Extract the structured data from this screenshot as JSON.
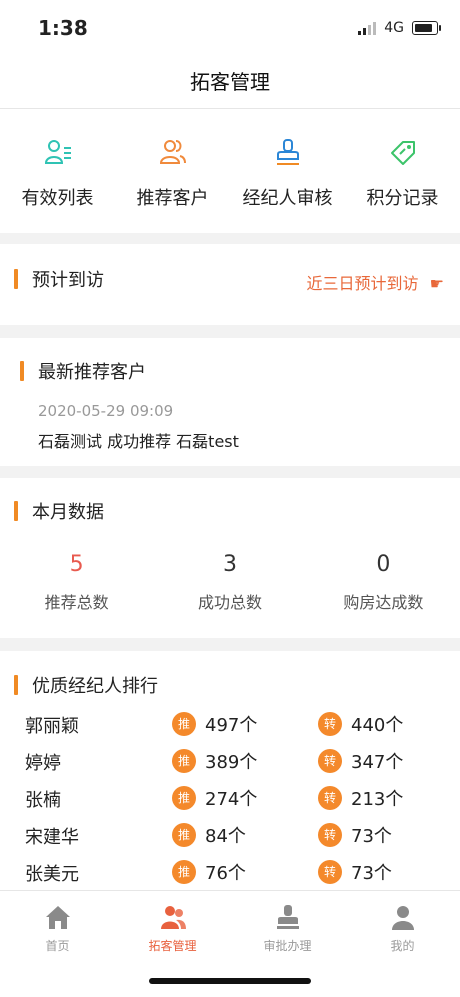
{
  "status_bar": {
    "time": "1:38",
    "network": "4G"
  },
  "header": {
    "title": "拓客管理"
  },
  "menu": [
    {
      "label": "有效列表",
      "icon": "user-list-icon"
    },
    {
      "label": "推荐客户",
      "icon": "users-icon"
    },
    {
      "label": "经纪人审核",
      "icon": "stamp-icon"
    },
    {
      "label": "积分记录",
      "icon": "tag-icon"
    }
  ],
  "visit": {
    "title": "预计到访",
    "link_label": "近三日预计到访",
    "link_icon": "pointing-hand-icon"
  },
  "recommend": {
    "title": "最新推荐客户",
    "time": "2020-05-29 09:09",
    "text": "石磊测试 成功推荐 石磊test"
  },
  "monthly": {
    "title": "本月数据",
    "items": [
      {
        "value": "5",
        "label": "推荐总数"
      },
      {
        "value": "3",
        "label": "成功总数"
      },
      {
        "value": "0",
        "label": "购房达成数"
      }
    ]
  },
  "ranking": {
    "title": "优质经纪人排行",
    "badge_push": "推",
    "badge_transfer": "转",
    "rows": [
      {
        "name": "郭丽颖",
        "push": "497个",
        "transfer": "440个"
      },
      {
        "name": "婷婷",
        "push": "389个",
        "transfer": "347个"
      },
      {
        "name": "张楠",
        "push": "274个",
        "transfer": "213个"
      },
      {
        "name": "宋建华",
        "push": "84个",
        "transfer": "73个"
      },
      {
        "name": "张美元",
        "push": "76个",
        "transfer": "73个"
      }
    ]
  },
  "tabbar": [
    {
      "label": "首页",
      "icon": "home-icon",
      "active": false
    },
    {
      "label": "拓客管理",
      "icon": "customers-icon",
      "active": true
    },
    {
      "label": "审批办理",
      "icon": "approval-stamp-icon",
      "active": false
    },
    {
      "label": "我的",
      "icon": "profile-icon",
      "active": false
    }
  ],
  "colors": {
    "accent": "#f08a24",
    "active": "#e8613e",
    "link": "#e8683a",
    "badge": "#f4892b"
  }
}
